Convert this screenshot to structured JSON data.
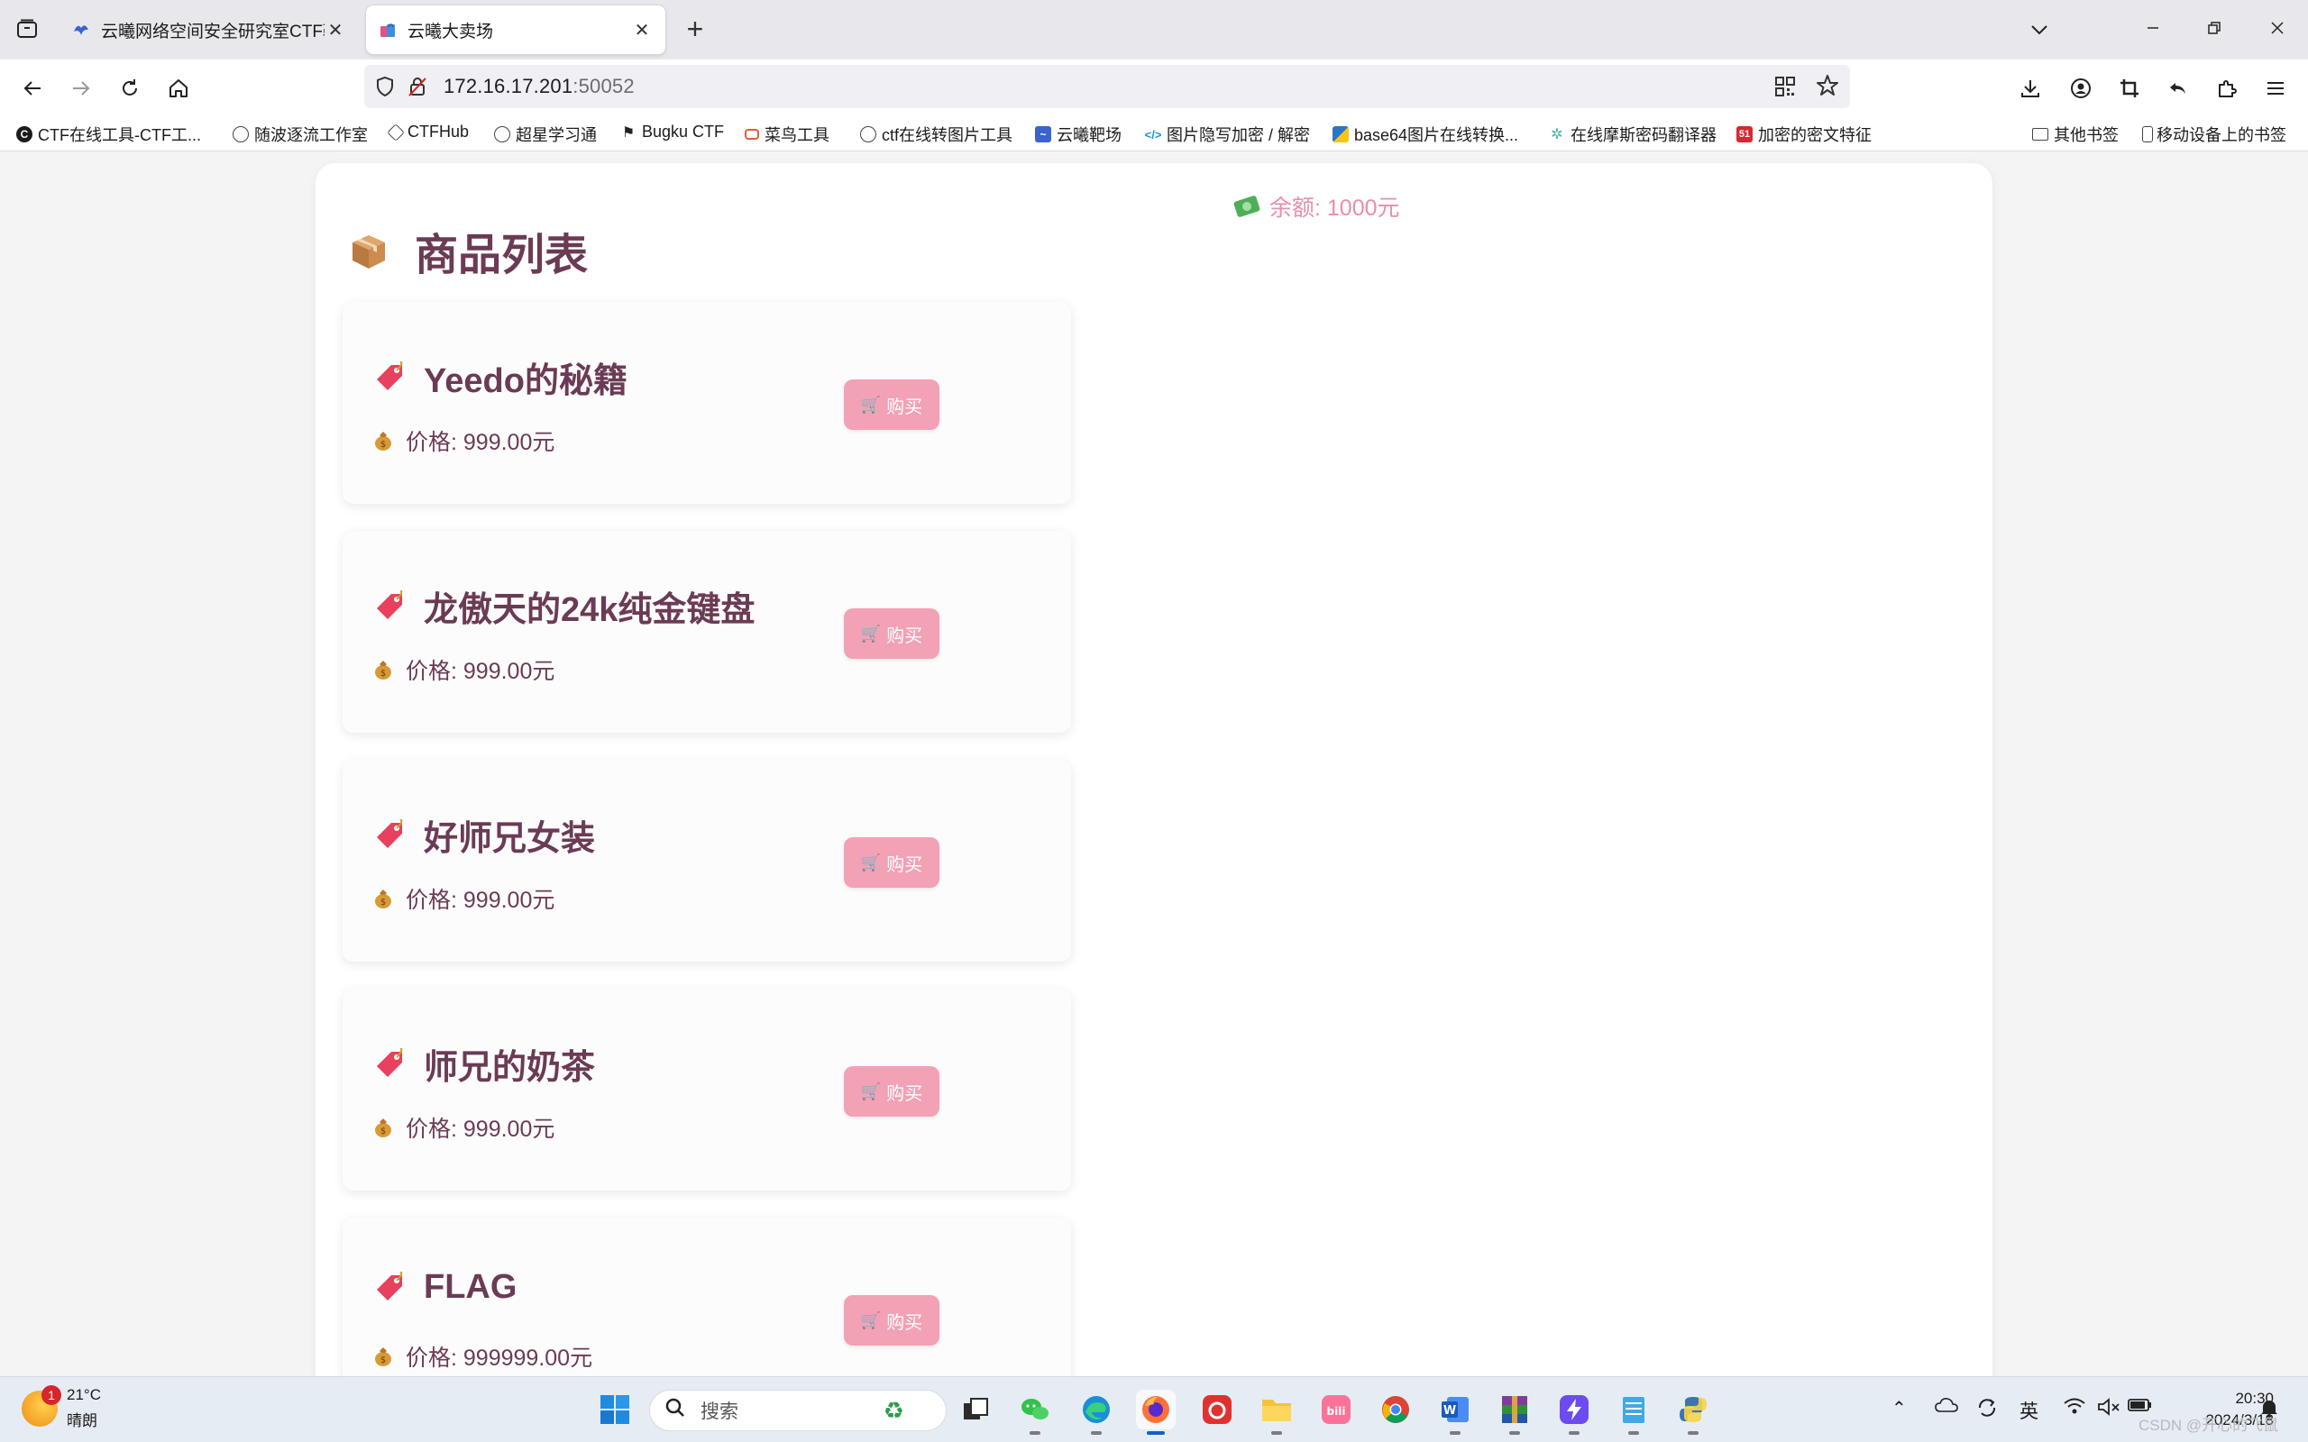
{
  "browser": {
    "tabs": [
      {
        "title": "云曦网络空间安全研究室CTF靶",
        "active": false
      },
      {
        "title": "云曦大卖场",
        "active": true
      }
    ],
    "new_tab": "+",
    "url": {
      "host": "172.16.17.201",
      "port": ":50052"
    },
    "bookmarks": [
      {
        "label": "CTF在线工具-CTF工...",
        "icon": "ctf-tools-icon",
        "color": "#1b1b1b"
      },
      {
        "label": "随波逐流工作室",
        "icon": "globe-icon",
        "color": "#555555"
      },
      {
        "label": "CTFHub",
        "icon": "ctfhub-icon",
        "color": "#555555"
      },
      {
        "label": "超星学习通",
        "icon": "globe-icon",
        "color": "#555555"
      },
      {
        "label": "Bugku CTF",
        "icon": "flag-icon",
        "color": "#333333"
      },
      {
        "label": "菜鸟工具",
        "icon": "runoob-icon",
        "color": "#e05d3a"
      },
      {
        "label": "ctf在线转图片工具",
        "icon": "globe-icon",
        "color": "#555555"
      },
      {
        "label": "云曦靶场",
        "icon": "yunxi-icon",
        "color": "#2f57c9"
      },
      {
        "label": "图片隐写加密 / 解密",
        "icon": "code-icon",
        "color": "#1f8fe0"
      },
      {
        "label": "base64图片在线转换...",
        "icon": "base64-icon",
        "color": "#2a76c6"
      },
      {
        "label": "在线摩斯密码翻译器",
        "icon": "morse-icon",
        "color": "#3fb8a6"
      },
      {
        "label": "加密的密文特征",
        "icon": "51cto-icon",
        "color": "#d7282f"
      }
    ],
    "other_bookmarks": "其他书签",
    "mobile_bookmarks": "移动设备上的书签"
  },
  "page": {
    "balance": "余额: 1000元",
    "title": "商品列表",
    "buy_label": "购买",
    "products": [
      {
        "name": "Yeedo的秘籍",
        "price": "价格: 999.00元"
      },
      {
        "name": "龙傲天的24k纯金键盘",
        "price": "价格: 999.00元"
      },
      {
        "name": "好师兄女装",
        "price": "价格: 999.00元"
      },
      {
        "name": "师兄的奶茶",
        "price": "价格: 999.00元"
      },
      {
        "name": "FLAG",
        "price": "价格: 999999.00元"
      }
    ]
  },
  "taskbar": {
    "weather": {
      "temp": "21°C",
      "desc": "晴朗",
      "badge": "1"
    },
    "search_placeholder": "搜索",
    "apps": [
      "windows-start",
      "taskview",
      "wechat",
      "edge",
      "firefox",
      "netease-music",
      "file-explorer",
      "bilibili",
      "chrome",
      "word",
      "winrar",
      "thunder",
      "notepad",
      "python"
    ],
    "ime": "英",
    "time": "20:30",
    "date": "2024/3/18",
    "watermark": "CSDN @开心的飞鼠"
  }
}
